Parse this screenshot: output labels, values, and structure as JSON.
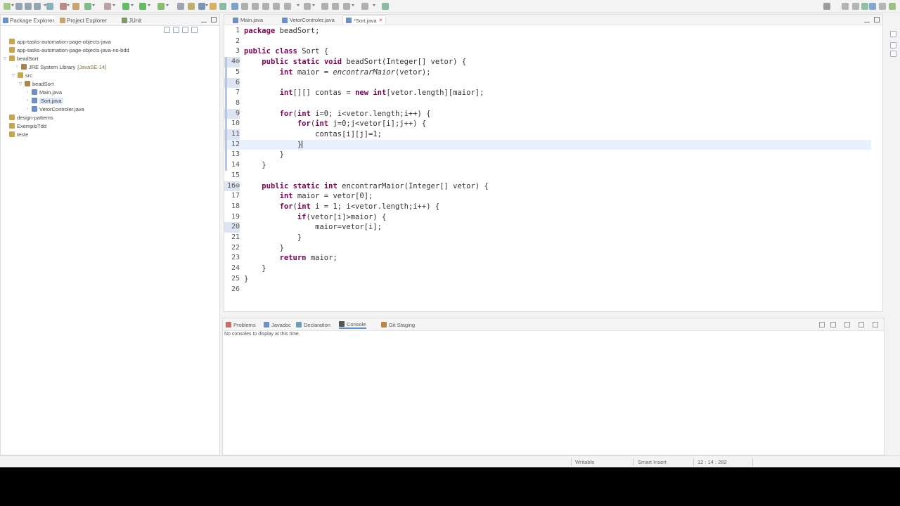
{
  "left_panel": {
    "tabs": [
      {
        "label": "Package Explorer",
        "active": true
      },
      {
        "label": "Project Explorer",
        "active": false
      },
      {
        "label": "JUnit",
        "active": false
      }
    ],
    "tree": [
      {
        "label": "app-tasks-automation-page-objects-java",
        "icon": "project-icon"
      },
      {
        "label": "app-tasks-automation-page-objects-java-no-bdd",
        "icon": "project-icon"
      },
      {
        "label": "beadSort",
        "icon": "project-icon"
      },
      {
        "label": "JRE System Library",
        "suffix": "[JavaSE-14]",
        "icon": "library-icon"
      },
      {
        "label": "src",
        "icon": "source-folder-icon"
      },
      {
        "label": "beadSort",
        "icon": "package-icon"
      },
      {
        "label": "Main.java",
        "icon": "java-file-icon"
      },
      {
        "label": "Sort.java",
        "icon": "java-file-icon",
        "selected": true
      },
      {
        "label": "VetorControler.java",
        "icon": "java-file-icon"
      },
      {
        "label": "design-patterns",
        "icon": "project-icon"
      },
      {
        "label": "ExemploTdd",
        "icon": "project-icon"
      },
      {
        "label": "teste",
        "icon": "project-icon"
      }
    ]
  },
  "editor": {
    "tabs": [
      {
        "label": "Main.java",
        "active": false
      },
      {
        "label": "VetorControler.java",
        "active": false
      },
      {
        "label": "*Sort.java",
        "active": true
      }
    ],
    "lines": [
      {
        "n": "1",
        "text": "package beadSort;"
      },
      {
        "n": "2",
        "text": ""
      },
      {
        "n": "3",
        "text": "public class Sort {"
      },
      {
        "n": "4⊖",
        "text": "    public static void beadSort(Integer[] vetor) {"
      },
      {
        "n": "5",
        "text": "        int maior = encontrarMaior(vetor);"
      },
      {
        "n": "6",
        "text": ""
      },
      {
        "n": "7",
        "text": "        int[][] contas = new int[vetor.length][maior];"
      },
      {
        "n": "8",
        "text": ""
      },
      {
        "n": "9",
        "text": "        for(int i=0; i<vetor.length;i++) {"
      },
      {
        "n": "10",
        "text": "            for(int j=0;j<vetor[i];j++) {"
      },
      {
        "n": "11",
        "text": "                contas[i][j]=1;"
      },
      {
        "n": "12",
        "text": "            }"
      },
      {
        "n": "13",
        "text": "        }"
      },
      {
        "n": "14",
        "text": "    }"
      },
      {
        "n": "15",
        "text": ""
      },
      {
        "n": "16⊖",
        "text": "    public static int encontrarMaior(Integer[] vetor) {"
      },
      {
        "n": "17",
        "text": "        int maior = vetor[0];"
      },
      {
        "n": "18",
        "text": "        for(int i = 1; i<vetor.length;i++) {"
      },
      {
        "n": "19",
        "text": "            if(vetor[i]>maior) {"
      },
      {
        "n": "20",
        "text": "                maior=vetor[i];"
      },
      {
        "n": "21",
        "text": "            }"
      },
      {
        "n": "22",
        "text": "        }"
      },
      {
        "n": "23",
        "text": "        return maior;"
      },
      {
        "n": "24",
        "text": "    }"
      },
      {
        "n": "25",
        "text": "}"
      },
      {
        "n": "26",
        "text": ""
      }
    ],
    "current_line": "12"
  },
  "bottom_panel": {
    "tabs": [
      {
        "label": "Problems",
        "active": false
      },
      {
        "label": "Javadoc",
        "active": false
      },
      {
        "label": "Declaration",
        "active": false
      },
      {
        "label": "Console",
        "active": true
      },
      {
        "label": "Git Staging",
        "active": false
      }
    ],
    "console_message": "No consoles to display at this time."
  },
  "status_bar": {
    "writable": "Writable",
    "insert_mode": "Smart Insert",
    "position": "12 : 14 : 282"
  },
  "colors": {
    "keyword": "#7f0055",
    "current_line": "#e8f2fe",
    "selection": "#dbe8f7"
  }
}
